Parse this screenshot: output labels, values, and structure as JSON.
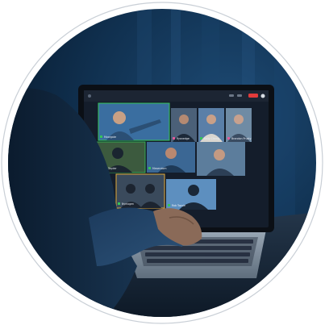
{
  "photo": {
    "tiles": [
      {
        "label": "Moorgate",
        "speaking": true
      },
      {
        "label": "Ryanedge",
        "speaking": false
      },
      {
        "label": "Kelly Chang",
        "speaking": false
      },
      {
        "label": "Brandon Prusty",
        "speaking": false
      },
      {
        "label": "Rob Tayder",
        "speaking": false
      },
      {
        "label": "Mesendom",
        "speaking": false
      },
      {
        "label": "",
        "speaking": false
      },
      {
        "label": "Nyelogen",
        "speaking": false
      },
      {
        "label": "Rob Topsie",
        "speaking": false
      }
    ],
    "colors": {
      "room": "#0e2740",
      "screen_bezel": "#0b0f15",
      "accent_green": "#36c55a",
      "end_call_red": "#e23b3b",
      "outer_ring": "#c9cfd6"
    }
  }
}
